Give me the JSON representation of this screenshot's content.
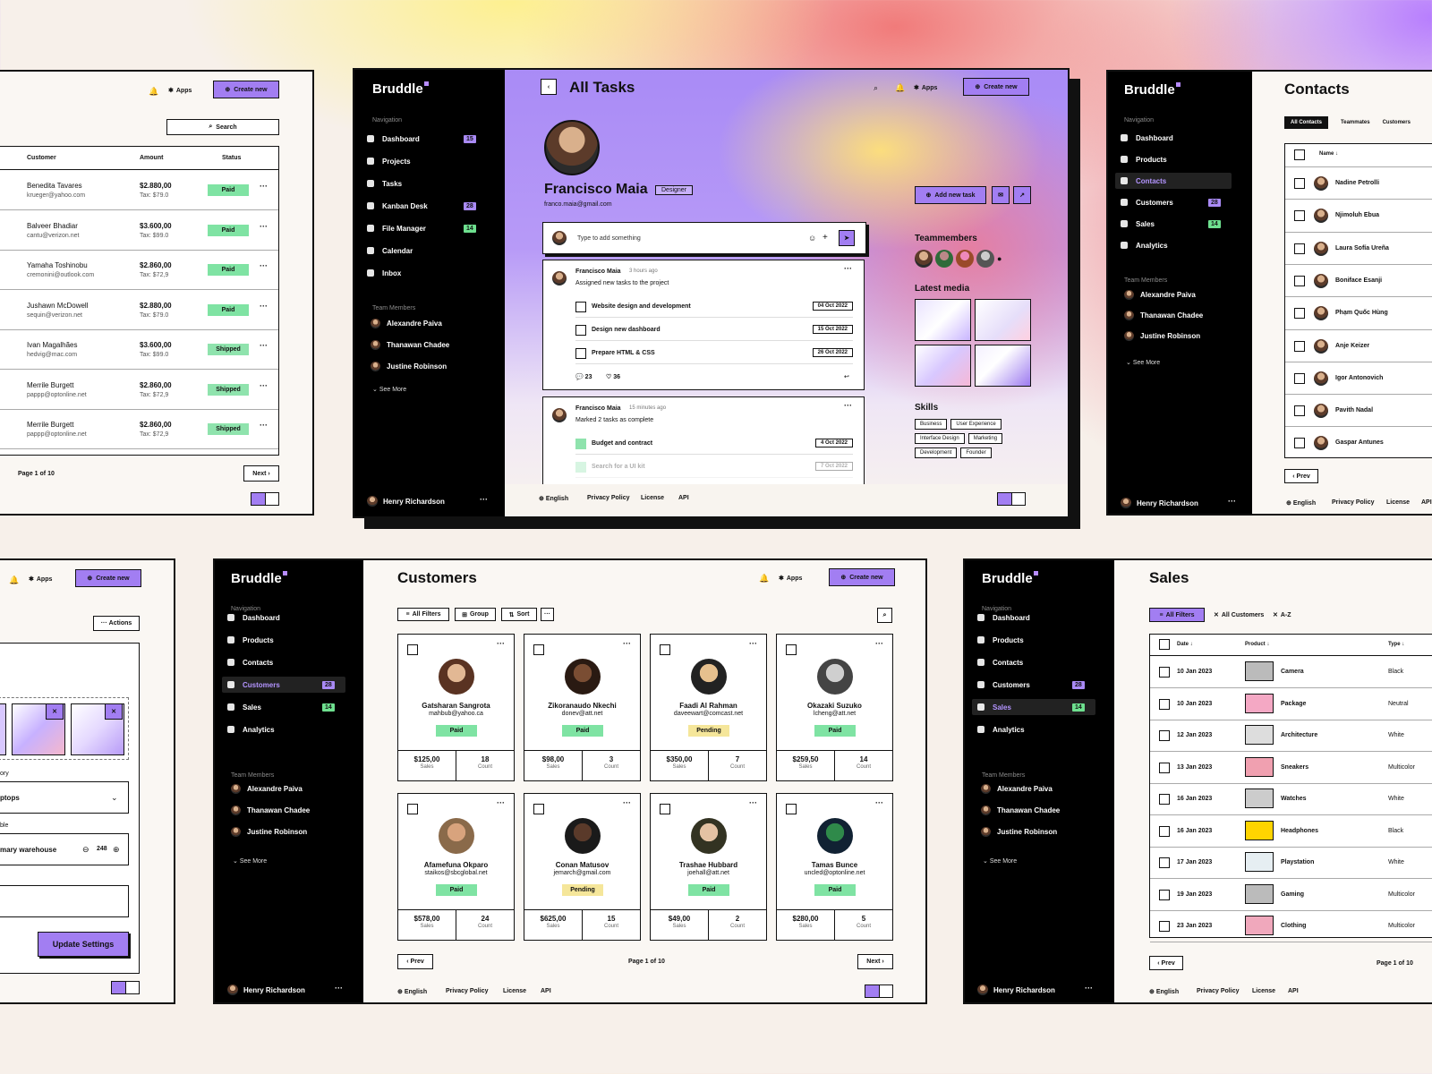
{
  "brand": "Bruddle",
  "common": {
    "apps": "Apps",
    "create_new": "Create new",
    "navigation": "Navigation",
    "team_members_label": "Team Members",
    "see_more": "See More",
    "user": "Henry Richardson",
    "english": "English",
    "privacy": "Privacy Policy",
    "license": "License",
    "api": "API",
    "prev": "Prev",
    "next": "Next",
    "page": "Page 1 of 10"
  },
  "team": [
    "Alexandre Paiva",
    "Thanawan Chadee",
    "Justine Robinson"
  ],
  "orders": {
    "search": "Search",
    "headers": [
      "Customer",
      "Amount",
      "Status"
    ],
    "rows": [
      {
        "name": "Benedita Tavares",
        "email": "krueger@yahoo.com",
        "amount": "$2.880,00",
        "tax": "Tax: $79.0",
        "status": "Paid"
      },
      {
        "name": "Balveer Bhadiar",
        "email": "cantu@verizon.net",
        "amount": "$3.600,00",
        "tax": "Tax: $99.0",
        "status": "Paid"
      },
      {
        "name": "Yamaha Toshinobu",
        "email": "cremonini@outlook.com",
        "amount": "$2.860,00",
        "tax": "Tax: $72,9",
        "status": "Paid"
      },
      {
        "name": "Jushawn McDowell",
        "email": "sequin@verizon.net",
        "amount": "$2.880,00",
        "tax": "Tax: $79.0",
        "status": "Paid"
      },
      {
        "name": "Ivan Magalhães",
        "email": "hedvig@mac.com",
        "amount": "$3.600,00",
        "tax": "Tax: $99.0",
        "status": "Shipped"
      },
      {
        "name": "Merrile Burgett",
        "email": "pappp@optonline.net",
        "amount": "$2.860,00",
        "tax": "Tax: $72,9",
        "status": "Shipped"
      },
      {
        "name": "Merrile Burgett",
        "email": "pappp@optonline.net",
        "amount": "$2.860,00",
        "tax": "Tax: $72,9",
        "status": "Shipped"
      }
    ]
  },
  "tasks": {
    "title": "All Tasks",
    "nav": [
      {
        "label": "Dashboard",
        "badge": "15"
      },
      {
        "label": "Projects",
        "badge": ""
      },
      {
        "label": "Tasks",
        "badge": ""
      },
      {
        "label": "Kanban Desk",
        "badge": "28"
      },
      {
        "label": "File Manager",
        "badge": "14"
      },
      {
        "label": "Calendar",
        "badge": ""
      },
      {
        "label": "Inbox",
        "badge": ""
      }
    ],
    "profile": {
      "name": "Francisco Maia",
      "role": "Designer",
      "email": "franco.maia@gmail.com"
    },
    "add_task": "Add new task",
    "input_placeholder": "Type to add something",
    "post1": {
      "author": "Francisco Maia",
      "time": "3 hours ago",
      "text": "Assigned new tasks to the project",
      "items": [
        {
          "label": "Website design and development",
          "date": "04 Oct 2022"
        },
        {
          "label": "Design new dashboard",
          "date": "15 Oct 2022"
        },
        {
          "label": "Prepare HTML & CSS",
          "date": "26 Oct 2022"
        }
      ],
      "comments": "23",
      "likes": "36"
    },
    "post2": {
      "author": "Francisco Maia",
      "time": "15 minutes ago",
      "text": "Marked 2 tasks as complete",
      "items": [
        {
          "label": "Budget and contract",
          "date": "4 Oct 2022"
        },
        {
          "label": "Search for a UI kit",
          "date": "7 Oct 2022"
        }
      ]
    },
    "teammembers_title": "Teammembers",
    "latest_media_title": "Latest media",
    "skills_title": "Skills",
    "skills": [
      "Business",
      "User Experience",
      "Interface Design",
      "Marketing",
      "Development",
      "Founder"
    ]
  },
  "contacts": {
    "title": "Contacts",
    "tabs": [
      "All Contacts",
      "Teammates",
      "Customers"
    ],
    "nav": [
      {
        "label": "Dashboard",
        "badge": ""
      },
      {
        "label": "Products",
        "badge": ""
      },
      {
        "label": "Contacts",
        "badge": ""
      },
      {
        "label": "Customers",
        "badge": "28"
      },
      {
        "label": "Sales",
        "badge": "14"
      },
      {
        "label": "Analytics",
        "badge": ""
      }
    ],
    "name_header": "Name",
    "people": [
      "Nadine Petrolli",
      "Njimoluh Ebua",
      "Laura Sofía Ureña",
      "Boniface Esanji",
      "Phạm Quốc Hùng",
      "Anje Keizer",
      "Igor Antonovich",
      "Pavith Nadal",
      "Gaspar Antunes"
    ]
  },
  "settings": {
    "actions": "Actions",
    "category_value": "ptops",
    "category_label": "ory",
    "warehouse_label": "ble",
    "warehouse": "mary warehouse",
    "qty": "248",
    "update": "Update Settings"
  },
  "customers": {
    "title": "Customers",
    "nav": [
      {
        "label": "Dashboard",
        "badge": ""
      },
      {
        "label": "Products",
        "badge": ""
      },
      {
        "label": "Contacts",
        "badge": ""
      },
      {
        "label": "Customers",
        "badge": "28"
      },
      {
        "label": "Sales",
        "badge": "14"
      },
      {
        "label": "Analytics",
        "badge": ""
      }
    ],
    "filters": [
      "All Filters",
      "Group",
      "Sort"
    ],
    "sales_label": "Sales",
    "count_label": "Count",
    "cards": [
      {
        "name": "Gatsharan Sangrota",
        "email": "mahbub@yahoo.ca",
        "status": "Paid",
        "sales": "$125,00",
        "count": "18"
      },
      {
        "name": "Zikoranaudo Nkechi",
        "email": "donev@att.net",
        "status": "Paid",
        "sales": "$98,00",
        "count": "3"
      },
      {
        "name": "Faadi Al Rahman",
        "email": "daveewart@comcast.net",
        "status": "Pending",
        "sales": "$350,00",
        "count": "7"
      },
      {
        "name": "Okazaki Suzuko",
        "email": "lcheng@att.net",
        "status": "Paid",
        "sales": "$259,50",
        "count": "14"
      },
      {
        "name": "Afamefuna Okparo",
        "email": "staikos@sbcglobal.net",
        "status": "Paid",
        "sales": "$578,00",
        "count": "24"
      },
      {
        "name": "Conan Matusov",
        "email": "jemarch@gmail.com",
        "status": "Pending",
        "sales": "$625,00",
        "count": "15"
      },
      {
        "name": "Trashae Hubbard",
        "email": "joehall@att.net",
        "status": "Paid",
        "sales": "$49,00",
        "count": "2"
      },
      {
        "name": "Tamas Bunce",
        "email": "uncled@optonline.net",
        "status": "Paid",
        "sales": "$280,00",
        "count": "5"
      }
    ]
  },
  "sales": {
    "title": "Sales",
    "nav": [
      {
        "label": "Dashboard",
        "badge": ""
      },
      {
        "label": "Products",
        "badge": ""
      },
      {
        "label": "Contacts",
        "badge": ""
      },
      {
        "label": "Customers",
        "badge": "28"
      },
      {
        "label": "Sales",
        "badge": "14"
      },
      {
        "label": "Analytics",
        "badge": ""
      }
    ],
    "filters": [
      "All Filters",
      "All Customers",
      "A-Z"
    ],
    "headers": [
      "Date",
      "Product",
      "Type"
    ],
    "rows": [
      {
        "date": "10 Jan 2023",
        "product": "Camera",
        "type": "Black"
      },
      {
        "date": "10 Jan 2023",
        "product": "Package",
        "type": "Neutral"
      },
      {
        "date": "12 Jan 2023",
        "product": "Architecture",
        "type": "White"
      },
      {
        "date": "13 Jan 2023",
        "product": "Sneakers",
        "type": "Multicolor"
      },
      {
        "date": "16 Jan 2023",
        "product": "Watches",
        "type": "White"
      },
      {
        "date": "16 Jan 2023",
        "product": "Headphones",
        "type": "Black"
      },
      {
        "date": "17 Jan 2023",
        "product": "Playstation",
        "type": "White"
      },
      {
        "date": "19 Jan 2023",
        "product": "Gaming",
        "type": "Multicolor"
      },
      {
        "date": "23 Jan 2023",
        "product": "Clothing",
        "type": "Multicolor"
      }
    ]
  }
}
